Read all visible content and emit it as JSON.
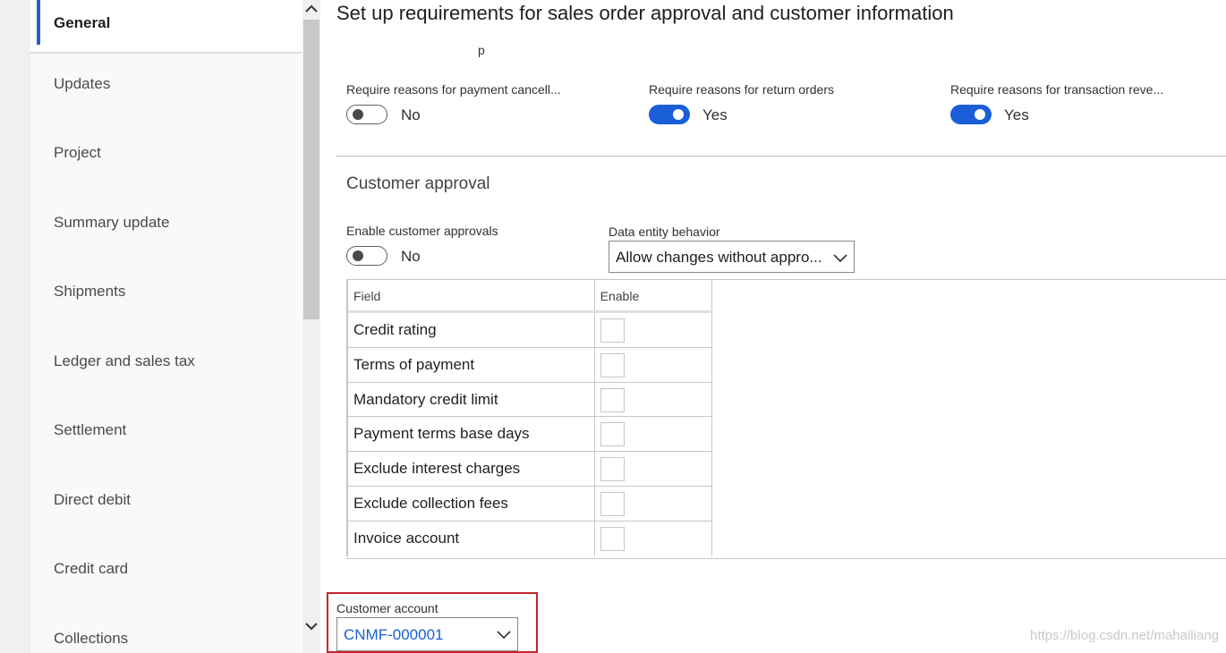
{
  "sidebar": {
    "items": [
      {
        "label": "General",
        "active": true
      },
      {
        "label": "Updates"
      },
      {
        "label": "Project"
      },
      {
        "label": "Summary update"
      },
      {
        "label": "Shipments"
      },
      {
        "label": "Ledger and sales tax"
      },
      {
        "label": "Settlement"
      },
      {
        "label": "Direct debit"
      },
      {
        "label": "Credit card"
      },
      {
        "label": "Collections"
      }
    ]
  },
  "page": {
    "title": "Set up requirements for sales order approval and customer information",
    "clipped_text": "p"
  },
  "reasons": {
    "payment_cancel": {
      "label": "Require reasons for payment cancell...",
      "value": "No",
      "on": false
    },
    "return_orders": {
      "label": "Require reasons for return orders",
      "value": "Yes",
      "on": true
    },
    "transaction_rev": {
      "label": "Require reasons for transaction reve...",
      "value": "Yes",
      "on": true
    }
  },
  "customer_approval": {
    "title": "Customer approval",
    "enable_label": "Enable customer approvals",
    "enable_value": "No",
    "data_entity_label": "Data entity behavior",
    "data_entity_value": "Allow changes without appro..."
  },
  "grid": {
    "columns": [
      "Field",
      "Enable"
    ],
    "rows": [
      {
        "field": "Credit rating",
        "enabled": false
      },
      {
        "field": "Terms of payment",
        "enabled": false
      },
      {
        "field": "Mandatory credit limit",
        "enabled": false
      },
      {
        "field": "Payment terms base days",
        "enabled": false
      },
      {
        "field": "Exclude interest charges",
        "enabled": false
      },
      {
        "field": "Exclude collection fees",
        "enabled": false
      },
      {
        "field": "Invoice account",
        "enabled": false
      }
    ]
  },
  "customer_account": {
    "label": "Customer account",
    "value": "CNMF-000001"
  },
  "watermark": "https://blog.csdn.net/mahailiang",
  "colors": {
    "accent": "#1a5fd8",
    "highlight": "#c4262e"
  }
}
